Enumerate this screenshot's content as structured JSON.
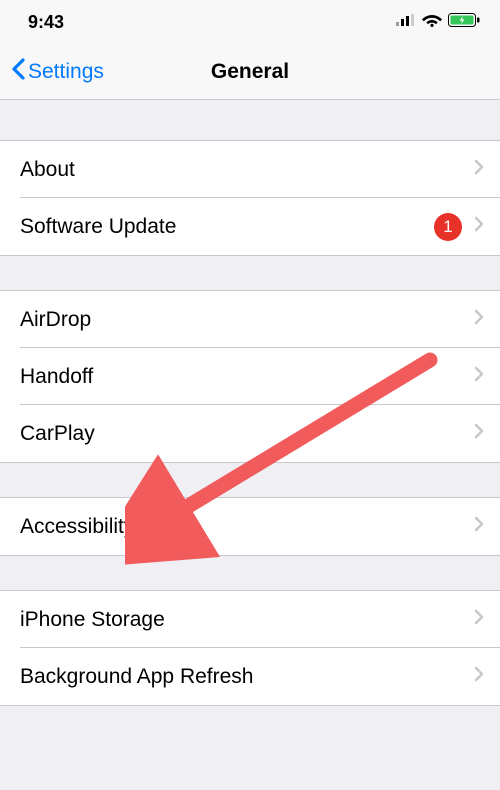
{
  "status_bar": {
    "time": "9:43"
  },
  "nav": {
    "back_label": "Settings",
    "title": "General"
  },
  "sections": [
    {
      "rows": [
        {
          "label": "About",
          "badge": null
        },
        {
          "label": "Software Update",
          "badge": "1"
        }
      ]
    },
    {
      "rows": [
        {
          "label": "AirDrop",
          "badge": null
        },
        {
          "label": "Handoff",
          "badge": null
        },
        {
          "label": "CarPlay",
          "badge": null
        }
      ]
    },
    {
      "rows": [
        {
          "label": "Accessibility",
          "badge": null
        }
      ]
    },
    {
      "rows": [
        {
          "label": "iPhone Storage",
          "badge": null
        },
        {
          "label": "Background App Refresh",
          "badge": null
        }
      ]
    }
  ]
}
